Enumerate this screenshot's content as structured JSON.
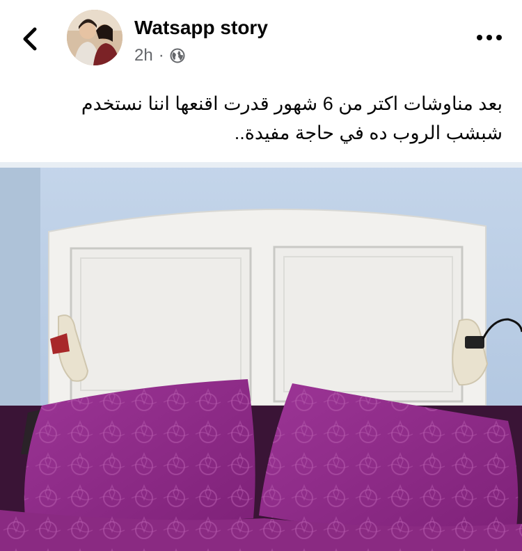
{
  "header": {
    "page_name": "Watsapp story",
    "time": "2h",
    "separator": "·",
    "audience_icon": "globe-icon",
    "back_icon": "chevron-left-icon",
    "more_icon": "more-horizontal-icon"
  },
  "post": {
    "text": "بعد مناوشات اكتر من 6 شهور قدرت اقنعها اننا نستخدم شبشب الروب ده في حاجة مفيدة..",
    "image_alt": "bed-headboard-with-slippers-photo"
  },
  "colors": {
    "wall": "#b9cde4",
    "headboard": "#f1f1ef",
    "pillow": "#8e2a86",
    "meta": "#65676b"
  }
}
